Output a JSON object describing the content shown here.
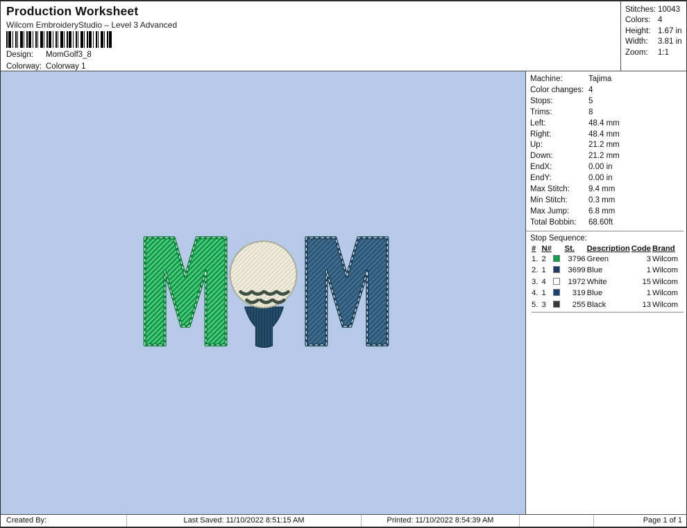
{
  "header": {
    "title": "Production Worksheet",
    "subtitle": "Wilcom EmbroideryStudio – Level 3 Advanced",
    "design_label": "Design:",
    "design_value": "MomGolf3_8",
    "colorway_label": "Colorway:",
    "colorway_value": "Colorway 1"
  },
  "summary": {
    "rows": [
      {
        "label": "Stitches:",
        "value": "10043"
      },
      {
        "label": "Colors:",
        "value": "4"
      },
      {
        "label": "Height:",
        "value": "1.67 in"
      },
      {
        "label": "Width:",
        "value": "3.81 in"
      },
      {
        "label": "Zoom:",
        "value": "1:1"
      }
    ]
  },
  "machine": {
    "rows": [
      {
        "label": "Machine:",
        "value": "Tajima"
      },
      {
        "label": "Color changes:",
        "value": "4"
      },
      {
        "label": "Stops:",
        "value": "5"
      },
      {
        "label": "Trims:",
        "value": "8"
      },
      {
        "label": "Left:",
        "value": "48.4 mm"
      },
      {
        "label": "Right:",
        "value": "48.4 mm"
      },
      {
        "label": "Up:",
        "value": "21.2 mm"
      },
      {
        "label": "Down:",
        "value": "21.2 mm"
      },
      {
        "label": "EndX:",
        "value": "0.00 in"
      },
      {
        "label": "EndY:",
        "value": "0.00 in"
      },
      {
        "label": "Max Stitch:",
        "value": "9.4 mm"
      },
      {
        "label": "Min Stitch:",
        "value": "0.3 mm"
      },
      {
        "label": "Max Jump:",
        "value": "6.8 mm"
      },
      {
        "label": "Total Bobbin:",
        "value": "68.60ft"
      }
    ]
  },
  "stop_sequence": {
    "title": "Stop Sequence:",
    "headers": {
      "num": "#",
      "n_num": "N#",
      "st": "St.",
      "description": "Description",
      "code": "Code",
      "brand": "Brand"
    },
    "rows": [
      {
        "num": "1.",
        "n": "2",
        "swatch": "#0f9e4a",
        "st": "3796",
        "description": "Green",
        "code": "3",
        "brand": "Wilcom"
      },
      {
        "num": "2.",
        "n": "1",
        "swatch": "#1b3d68",
        "st": "3699",
        "description": "Blue",
        "code": "1",
        "brand": "Wilcom"
      },
      {
        "num": "3.",
        "n": "4",
        "swatch": "#ffffff",
        "st": "1972",
        "description": "White",
        "code": "15",
        "brand": "Wilcom"
      },
      {
        "num": "4.",
        "n": "1",
        "swatch": "#1c4377",
        "st": "319",
        "description": "Blue",
        "code": "1",
        "brand": "Wilcom"
      },
      {
        "num": "5.",
        "n": "3",
        "swatch": "#3a3a3c",
        "st": "255",
        "description": "Black",
        "code": "13",
        "brand": "Wilcom"
      }
    ]
  },
  "design": {
    "name": "MOM golf embroidery",
    "colors": {
      "background": "#b6c9e7",
      "green": "#0ea14c",
      "green_hatch": "#7bd49a",
      "green_dark": "#0a7c39",
      "green_stitch": "#e2f6e8",
      "navy": "#2e587a",
      "navy_hatch": "#4d7795",
      "navy_dark": "#1a3c55",
      "navy_stitch": "#e4edf3",
      "ball": "#efecdd",
      "ball_hatch": "#d7d2ba",
      "ball_edge": "#a9ac98",
      "dimple": "#3f5047",
      "tee": "#27516e",
      "tee_hatch": "#16384f"
    }
  },
  "footer": {
    "created_by_label": "Created By:",
    "last_saved": "Last Saved: 11/10/2022 8:51:15 AM",
    "printed": "Printed: 11/10/2022 8:54:39 AM",
    "page": "Page 1 of 1"
  }
}
